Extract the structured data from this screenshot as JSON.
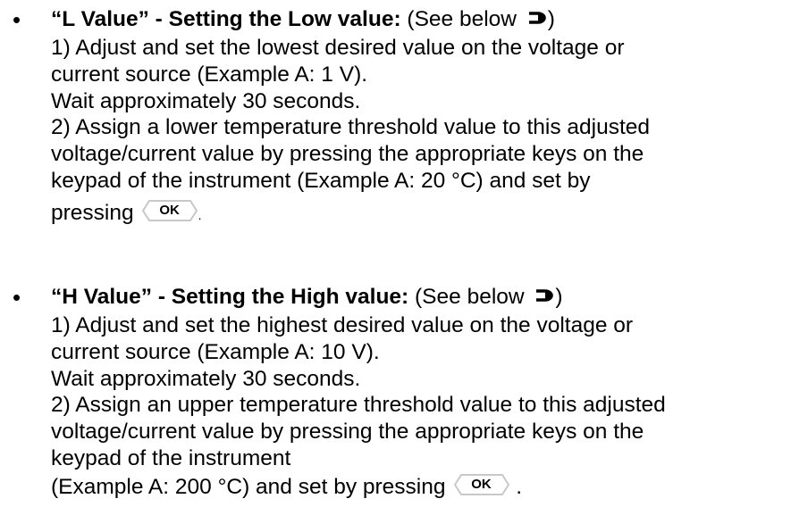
{
  "items": [
    {
      "heading_bold": "“L Value” - Setting the Low value:",
      "heading_rest_pre": " (See below ",
      "heading_rest_post": ")",
      "lines": [
        "1) Adjust and set the lowest desired value on the voltage or",
        "current source (Example A: 1 V).",
        "Wait approximately 30 seconds.",
        "2) Assign a lower temperature threshold value to this adjusted",
        "voltage/current value by pressing the appropriate keys on the",
        "keypad of the instrument (Example A: 20 °C) and set by"
      ],
      "final_text": "pressing",
      "ok_label": "OK",
      "final_suffix": "."
    },
    {
      "heading_bold": "“H Value” - Setting the High value:",
      "heading_rest_pre": " (See below ",
      "heading_rest_post": ")",
      "lines": [
        "1) Adjust and set the highest desired value on the voltage or",
        "current source (Example A: 10 V).",
        "Wait approximately 30 seconds.",
        "2) Assign an upper temperature threshold value to this adjusted",
        "voltage/current value by pressing the appropriate keys on the",
        "keypad of the instrument"
      ],
      "final_text": "(Example A: 200 °C) and set by pressing",
      "ok_label": "OK",
      "final_suffix": "."
    }
  ],
  "bullet_symbol": "•",
  "icons": {
    "arrow": "right-arrow-icon",
    "ok_key": "ok-key-icon"
  }
}
